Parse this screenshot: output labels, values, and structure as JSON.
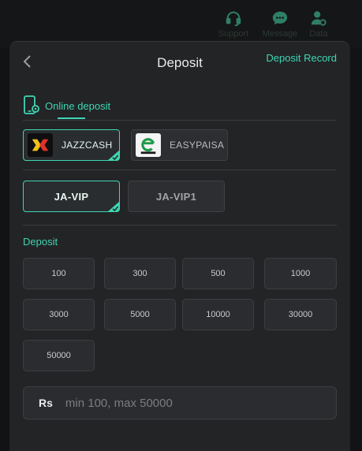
{
  "topnav": [
    {
      "label": "Support",
      "icon": "headset-icon"
    },
    {
      "label": "Message",
      "icon": "chat-bubble-icon"
    },
    {
      "label": "Data",
      "icon": "user-settings-icon"
    }
  ],
  "header": {
    "title": "Deposit",
    "record_link": "Deposit Record"
  },
  "tab": {
    "label": "Online deposit",
    "icon": "phone-settings-icon"
  },
  "payment_methods": [
    {
      "label": "JAZZCASH",
      "selected": true,
      "icon": "jazzcash-logo"
    },
    {
      "label": "EASYPAISA",
      "selected": false,
      "icon": "easypaisa-logo"
    }
  ],
  "channels": [
    {
      "label": "JA-VIP",
      "selected": true
    },
    {
      "label": "JA-VIP1",
      "selected": false
    }
  ],
  "deposit": {
    "section_label": "Deposit",
    "amounts": [
      "100",
      "300",
      "500",
      "1000",
      "3000",
      "5000",
      "10000",
      "30000",
      "50000"
    ],
    "currency": "Rs",
    "placeholder": "min 100, max 50000"
  },
  "colors": {
    "accent": "#3fd6b4",
    "background": "#232426",
    "card": "#2b2c2f"
  }
}
